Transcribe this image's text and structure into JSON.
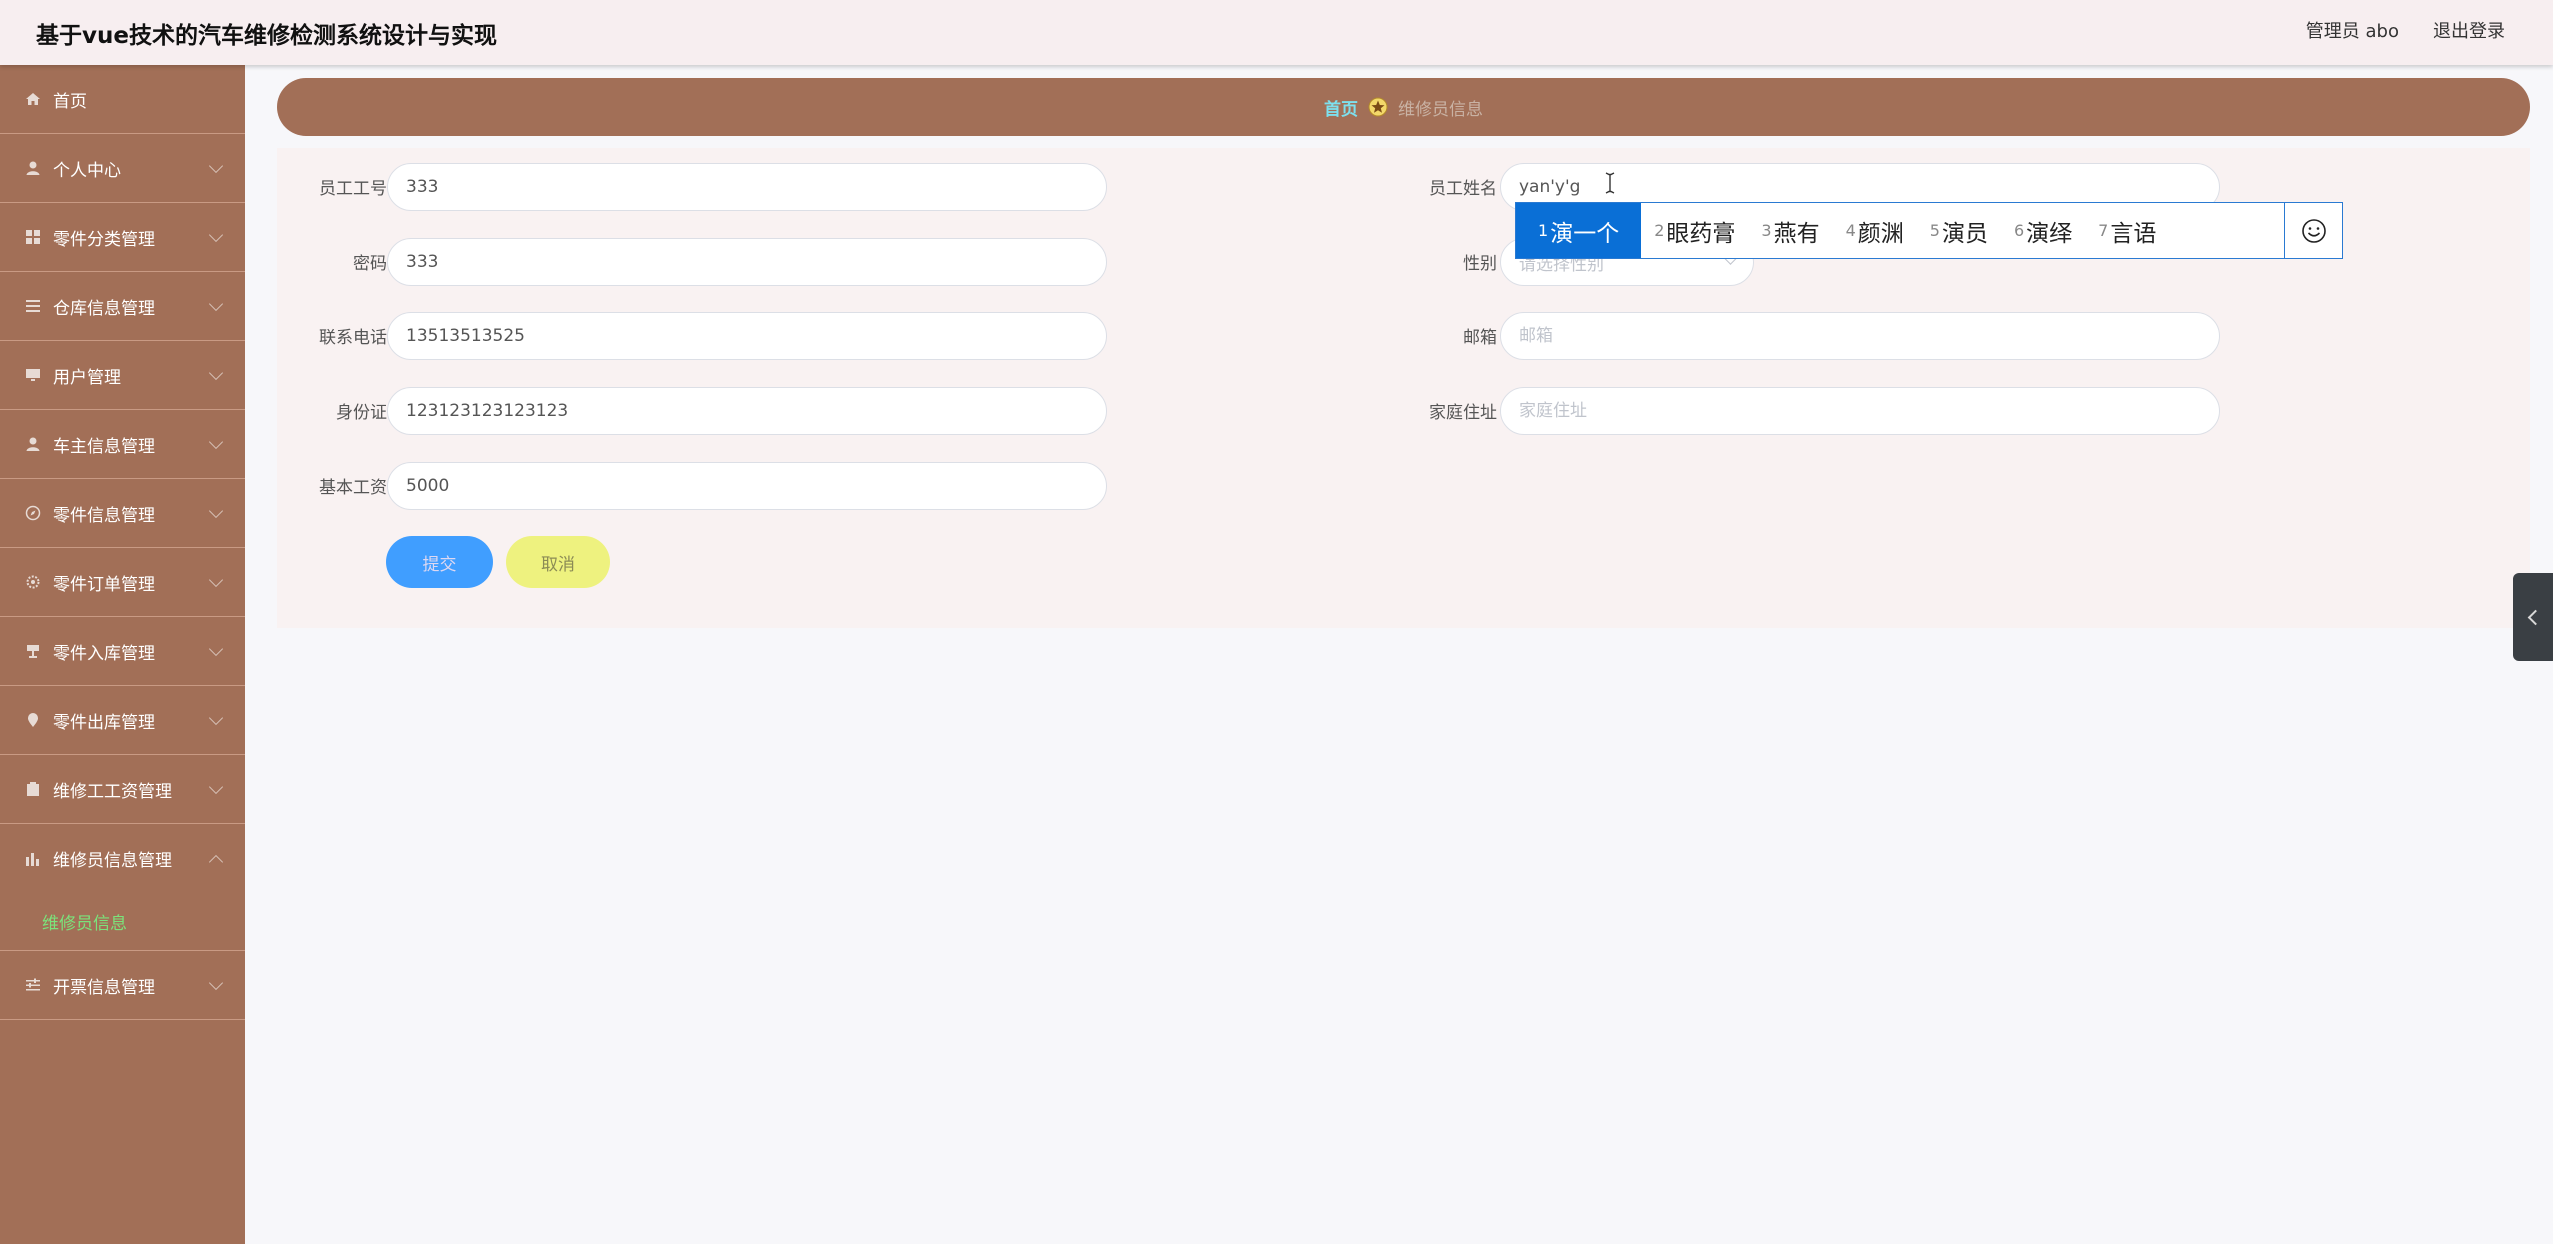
{
  "header": {
    "title": "基于vue技术的汽车维修检测系统设计与实现",
    "user": "管理员 abo",
    "logout": "退出登录"
  },
  "sidebar": {
    "items": [
      {
        "label": "首页",
        "icon": "home-icon"
      },
      {
        "label": "个人中心",
        "icon": "user-icon"
      },
      {
        "label": "零件分类管理",
        "icon": "grid-icon"
      },
      {
        "label": "仓库信息管理",
        "icon": "list-icon"
      },
      {
        "label": "用户管理",
        "icon": "monitor-icon"
      },
      {
        "label": "车主信息管理",
        "icon": "person-icon"
      },
      {
        "label": "零件信息管理",
        "icon": "compass-icon"
      },
      {
        "label": "零件订单管理",
        "icon": "gear-icon"
      },
      {
        "label": "零件入库管理",
        "icon": "stamp-icon"
      },
      {
        "label": "零件出库管理",
        "icon": "location-icon"
      },
      {
        "label": "维修工工资管理",
        "icon": "clipboard-icon"
      },
      {
        "label": "维修员信息管理",
        "icon": "chart-icon"
      },
      {
        "label": "开票信息管理",
        "icon": "sliders-icon"
      }
    ],
    "sub_item": "维修员信息"
  },
  "breadcrumb": {
    "home": "首页",
    "current": "维修员信息"
  },
  "form": {
    "employee_no": {
      "label": "员工工号",
      "value": "333"
    },
    "password": {
      "label": "密码",
      "value": "333"
    },
    "phone": {
      "label": "联系电话",
      "value": "13513513525"
    },
    "id_card": {
      "label": "身份证",
      "value": "123123123123123"
    },
    "base_salary": {
      "label": "基本工资",
      "value": "5000"
    },
    "employee_name": {
      "label": "员工姓名",
      "value": "yan'y'g"
    },
    "gender": {
      "label": "性别",
      "placeholder": "请选择性别"
    },
    "email": {
      "label": "邮箱",
      "placeholder": "邮箱"
    },
    "address": {
      "label": "家庭住址",
      "placeholder": "家庭住址"
    },
    "submit": "提交",
    "cancel": "取消"
  },
  "ime": {
    "candidates": [
      {
        "num": "1",
        "text": "演一个"
      },
      {
        "num": "2",
        "text": "眼药膏"
      },
      {
        "num": "3",
        "text": "燕有"
      },
      {
        "num": "4",
        "text": "颜渊"
      },
      {
        "num": "5",
        "text": "演员"
      },
      {
        "num": "6",
        "text": "演绎"
      },
      {
        "num": "7",
        "text": "言语"
      }
    ]
  },
  "colors": {
    "sidebar_bg": "#a26f57",
    "header_bg": "#f7eef0",
    "submit_btn": "#409eff",
    "cancel_btn": "#eef27f",
    "active_sub": "#7be37b",
    "crumb_home": "#7de0ee",
    "ime_active": "#0a6fd6"
  }
}
